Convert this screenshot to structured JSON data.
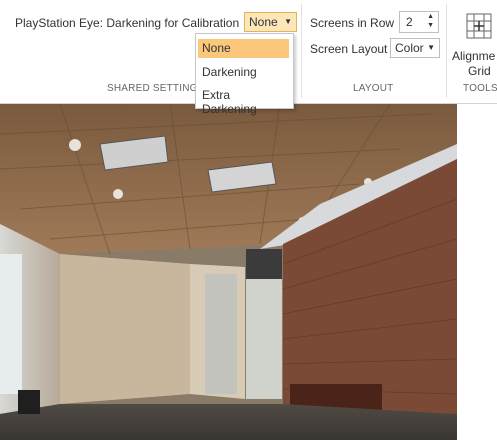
{
  "shared_settings": {
    "darkening_label": "PlayStation Eye: Darkening for Calibration",
    "darkening_value": "None",
    "dropdown_options": [
      "None",
      "Darkening",
      "Extra Darkening"
    ],
    "selected_option": "None",
    "group_label": "SHARED SETTINGS"
  },
  "layout": {
    "screens_in_row_label": "Screens in Row",
    "screens_in_row_value": "2",
    "screen_layout_label": "Screen Layout",
    "screen_layout_value": "Color",
    "group_label": "LAYOUT"
  },
  "tools": {
    "alignment_grid_label_1": "Alignme",
    "alignment_grid_label_2": "Grid",
    "group_label": "TOOLS"
  },
  "colors": {
    "highlight": "#fbc77a",
    "combo_highlight": "#fde7b8"
  }
}
